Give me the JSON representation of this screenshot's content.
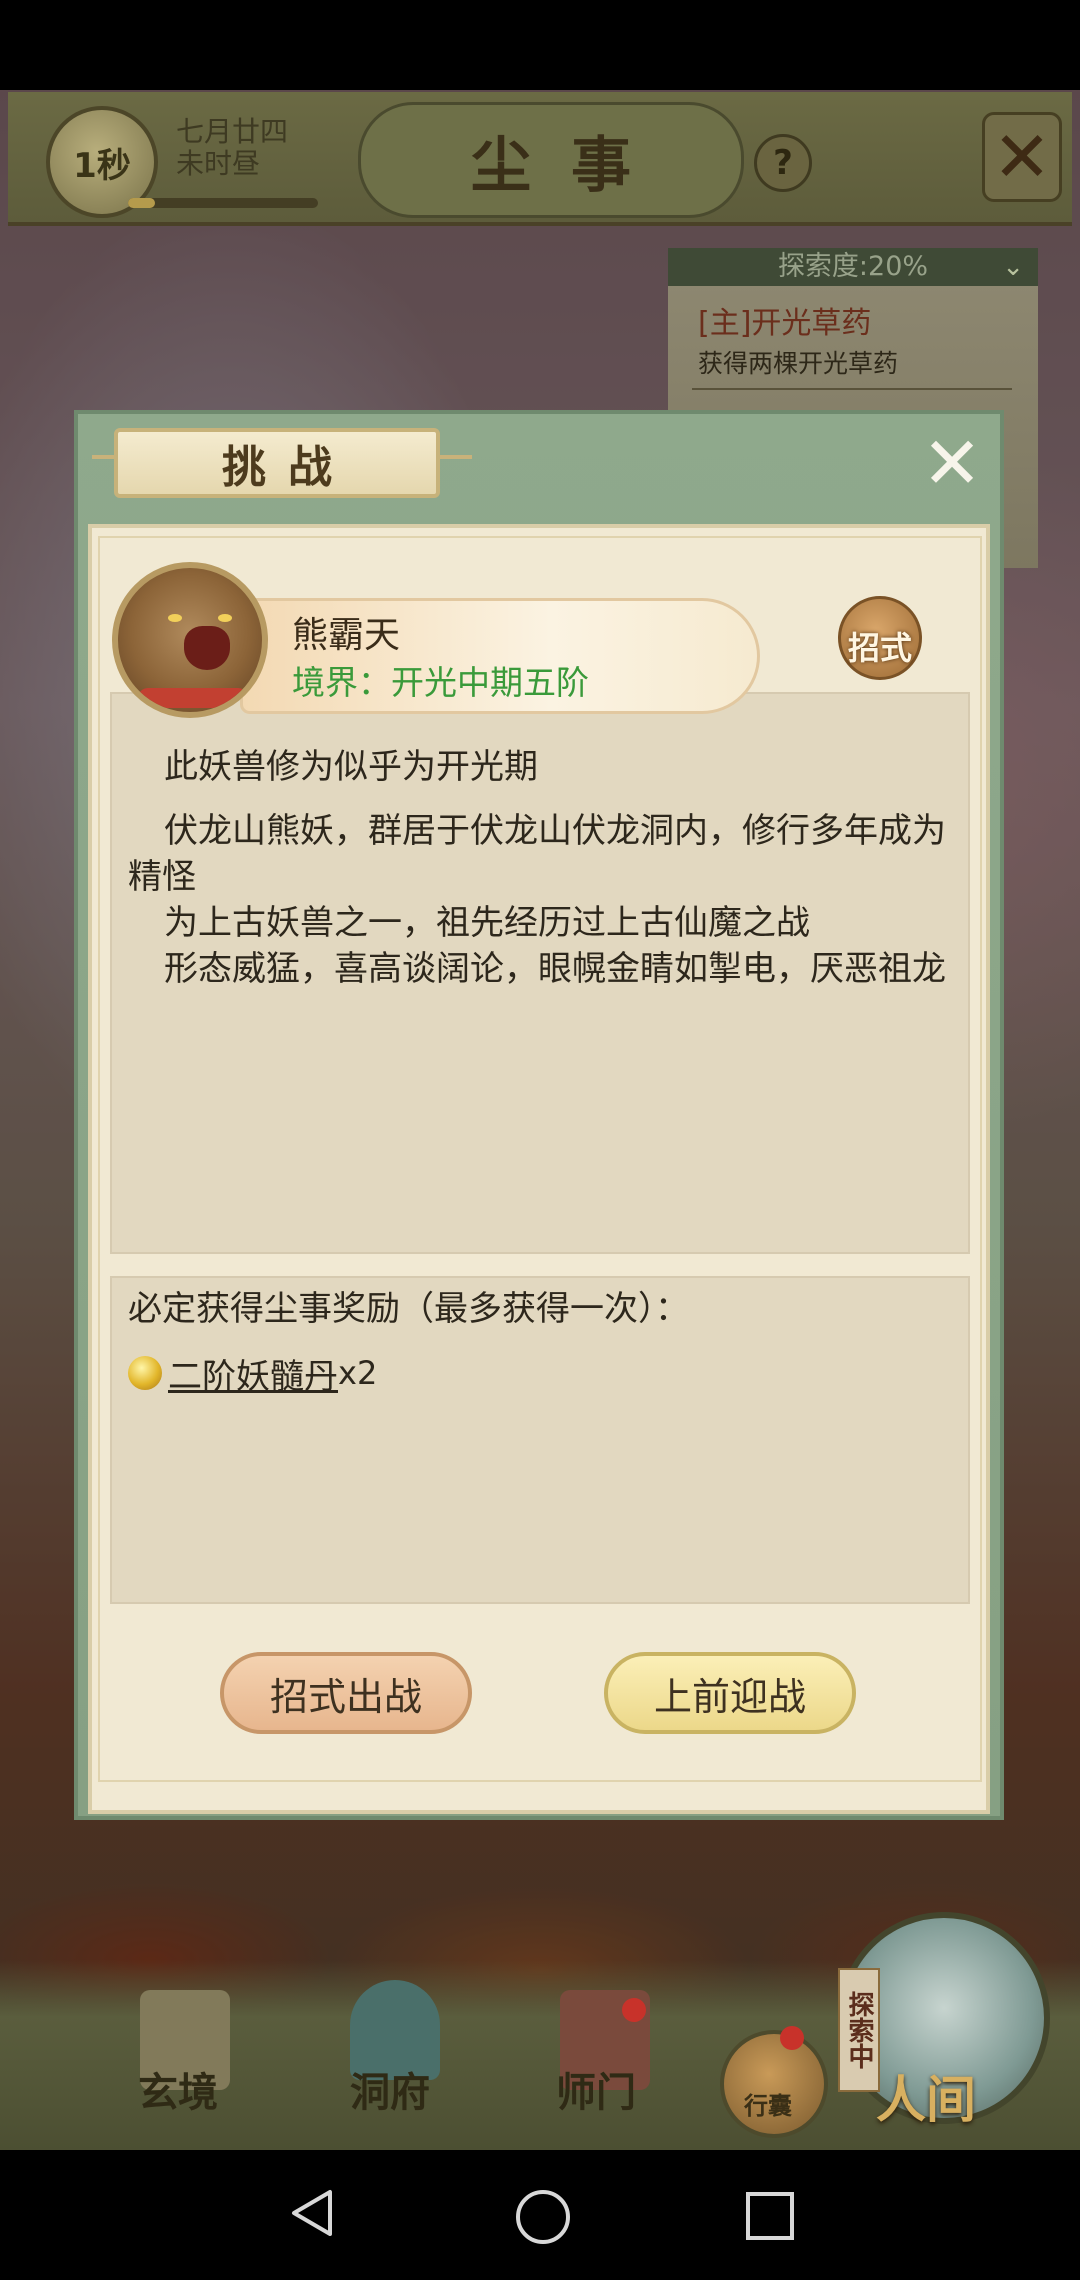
{
  "top_bar": {
    "timer": "1秒",
    "date_line1": "七月廿四",
    "date_line2": "未时昼",
    "day_progress_percent": 14,
    "title": "尘事",
    "help_label": "?",
    "close_label": "✕"
  },
  "quest": {
    "exploration": "探索度:20%",
    "main_title": "[主]开光草药",
    "main_desc": "获得两棵开光草药"
  },
  "dialog": {
    "tab_title": "挑战",
    "close_label": "✕",
    "boss_name": "熊霸天",
    "boss_realm": "境界：开光中期五阶",
    "moves_label": "招式",
    "desc_line1": "此妖兽修为似乎为开光期",
    "desc_body": [
      "伏龙山熊妖，群居于伏龙山伏龙洞内，修行多年成为精怪",
      "为上古妖兽之一，祖先经历过上古仙魔之战",
      "形态威猛，喜高谈阔论，眼幌金睛如掣电，厌恶祖龙"
    ],
    "reward_title": "必定获得尘事奖励（最多获得一次）：",
    "reward_item_name": "二阶妖髓丹",
    "reward_item_count": "x2",
    "btn_moves": "招式出战",
    "btn_engage": "上前迎战"
  },
  "bottom_nav": {
    "items": [
      "玄境",
      "洞府",
      "师门"
    ],
    "bag_label": "行囊",
    "explore_tag": "探索中",
    "world_label": "人间"
  },
  "colors": {
    "realm_text": "#3a9a3a",
    "dialog_frame": "#8fa98c",
    "dialog_body": "#f1e9d3",
    "btn_moves": "#e7b68e",
    "btn_engage": "#ecd88a"
  }
}
